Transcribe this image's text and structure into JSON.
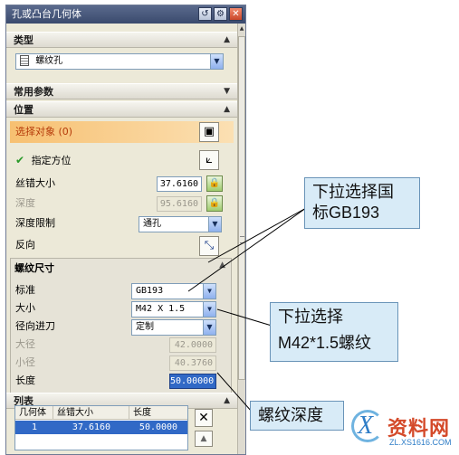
{
  "dialog": {
    "title": "孔或凸台几何体",
    "title_buttons": [
      "reset-icon",
      "gear-icon",
      "close-icon"
    ]
  },
  "sections": {
    "type": {
      "label": "类型",
      "combo_value": "螺纹孔",
      "icon": "threaded-hole-icon"
    },
    "common": {
      "label": "常用参数"
    },
    "position": {
      "label": "位置"
    }
  },
  "position": {
    "select_object": "选择对象 (0)",
    "specify_orientation": "指定方位",
    "thread_size_label": "丝错大小",
    "thread_size_value": "37.6160",
    "depth_label": "深度",
    "depth_value": "95.6160",
    "depth_limit_label": "深度限制",
    "depth_limit_value": "通孔",
    "reverse_label": "反向"
  },
  "thread": {
    "header": "螺纹尺寸",
    "standard_label": "标准",
    "standard_value": "GB193",
    "size_label": "大小",
    "size_value": "M42 X 1.5",
    "radial_label": "径向进刀",
    "radial_value": "定制",
    "major_label": "大径",
    "major_value": "42.0000",
    "minor_label": "小径",
    "minor_value": "40.3760",
    "length_label": "长度",
    "length_value": "50.00000"
  },
  "list": {
    "header": "列表",
    "columns": [
      "几何体",
      "丝错大小",
      "长度"
    ],
    "rows": [
      [
        "1",
        "37.6160",
        "50.0000"
      ]
    ]
  },
  "callouts": {
    "c1_line1": "下拉选择国",
    "c1_line2": "标GB193",
    "c2_line1": "下拉选择",
    "c2_line2": "M42*1.5螺纹",
    "c3": "螺纹深度"
  },
  "watermark": {
    "brand": "资料网",
    "url": "ZL.XS1616.COM"
  },
  "colors": {
    "title_bar": "#4a5a7d",
    "select_highlight": "#f7c071",
    "callout_bg": "#d8ebf7",
    "selection_blue": "#3169c6"
  }
}
